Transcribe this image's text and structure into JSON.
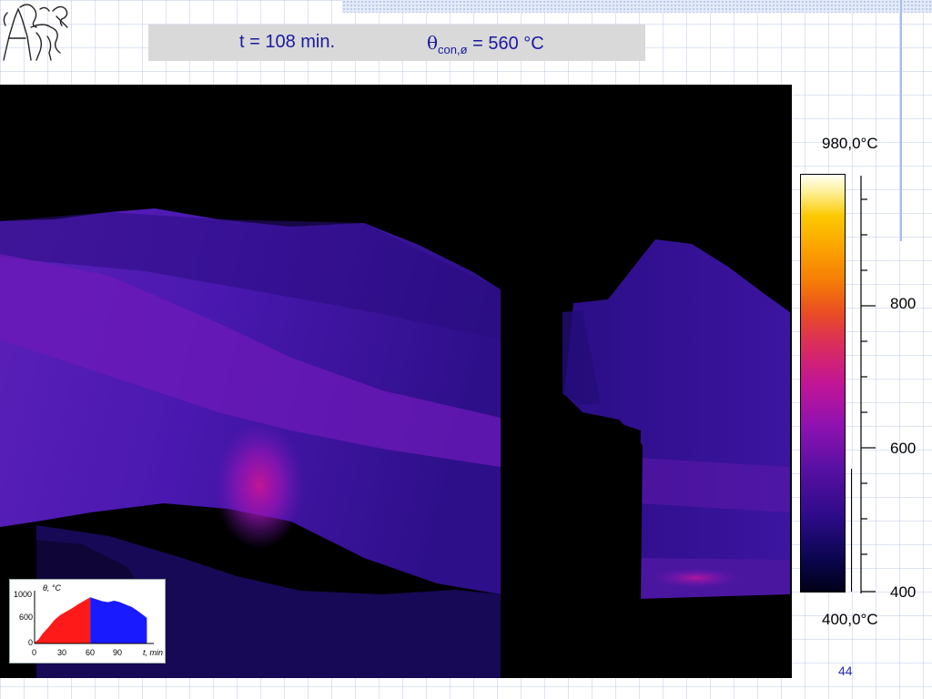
{
  "header": {
    "time_text": "t = 108 min.",
    "theta_symbol": "θ",
    "temp_subscript": "con,ø",
    "temp_value_text": " = 560 °C"
  },
  "page_number": "44",
  "color_scale": {
    "max_label": "980,0°C",
    "min_label": "400,0°C",
    "tick_labels": [
      "800",
      "600",
      "400"
    ],
    "range": [
      400,
      980
    ]
  },
  "inset_chart": {
    "ylabel": "θ, °C",
    "xlabel": "t, min",
    "y_ticks": [
      "1000",
      "600",
      "0"
    ],
    "x_ticks": [
      "0",
      "30",
      "60",
      "90"
    ],
    "colors": {
      "heating": "#ff1a1a",
      "cooling": "#1a1aff"
    }
  },
  "chart_data": {
    "type": "area",
    "xlabel": "t, min",
    "ylabel": "θ, °C",
    "xlim": [
      0,
      120
    ],
    "ylim": [
      0,
      1000
    ],
    "series": [
      {
        "x": [
          0,
          4,
          8,
          14,
          20,
          26,
          32,
          38,
          44,
          50,
          56
        ],
        "values": [
          20,
          80,
          200,
          330,
          480,
          580,
          650,
          720,
          800,
          870,
          940
        ]
      },
      {
        "x": [
          56,
          62,
          68,
          74,
          80,
          86,
          92,
          98,
          104,
          110,
          113
        ],
        "values": [
          940,
          900,
          860,
          840,
          870,
          840,
          790,
          740,
          660,
          570,
          520
        ]
      }
    ]
  }
}
